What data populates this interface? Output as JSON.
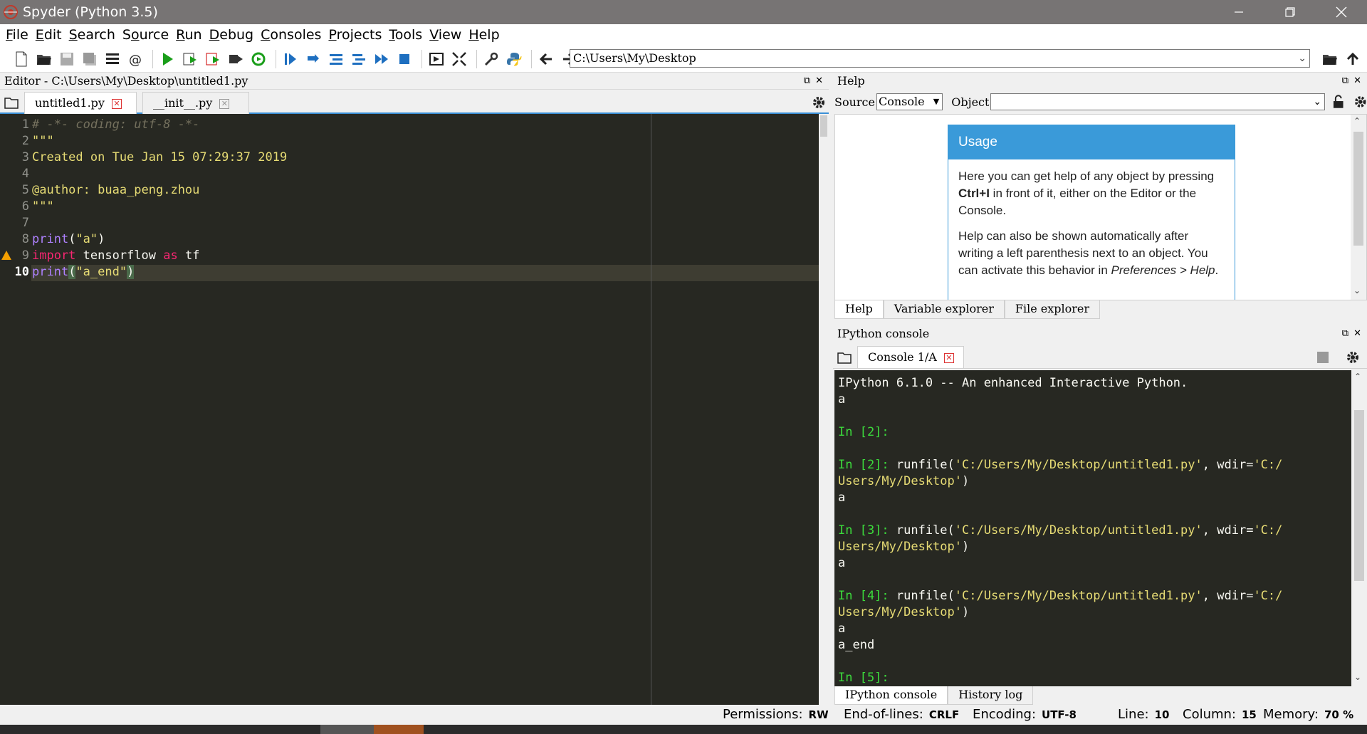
{
  "window": {
    "title": "Spyder (Python 3.5)"
  },
  "menu": [
    "File",
    "Edit",
    "Search",
    "Source",
    "Run",
    "Debug",
    "Consoles",
    "Projects",
    "Tools",
    "View",
    "Help"
  ],
  "menu_underline": [
    "F",
    "E",
    "S",
    "o",
    "R",
    "D",
    "C",
    "P",
    "T",
    "V",
    "H"
  ],
  "toolbar": {
    "path": "C:\\Users\\My\\Desktop"
  },
  "editor": {
    "header": "Editor - C:\\Users\\My\\Desktop\\untitled1.py",
    "tabs": [
      {
        "label": "untitled1.py",
        "active": true
      },
      {
        "label": "__init__.py",
        "active": false
      }
    ],
    "line_numbers": [
      "1",
      "2",
      "3",
      "4",
      "5",
      "6",
      "7",
      "8",
      "9",
      "10"
    ],
    "current_line": "10",
    "warning_line": "9",
    "lines": [
      "# -*- coding: utf-8 -*-",
      "\"\"\"",
      "Created on Tue Jan 15 07:29:37 2019",
      "",
      "@author: buaa_peng.zhou",
      "\"\"\"",
      "",
      "print(\"a\")",
      "import tensorflow as tf",
      "print(\"a_end\")"
    ],
    "tokens": {
      "l8_fn": "print",
      "l8_rest1": "(",
      "l8_str": "\"a\"",
      "l8_rest2": ")",
      "l9_kw1": "import",
      "l9_mid": " tensorflow ",
      "l9_kw2": "as",
      "l9_end": " tf",
      "l10_fn": "print",
      "l10_rest1": "(",
      "l10_str": "\"a_end\"",
      "l10_rest2": ")"
    }
  },
  "help": {
    "header": "Help",
    "source_label": "Source",
    "source_value": "Console",
    "object_label": "Object",
    "object_value": "",
    "usage_title": "Usage",
    "usage_p1_a": "Here you can get help of any object by pressing ",
    "usage_p1_b": "Ctrl+I",
    "usage_p1_c": " in front of it, either on the Editor or the Console.",
    "usage_p2_a": "Help can also be shown automatically after writing a left parenthesis next to an object. You can activate this behavior in ",
    "usage_p2_b": "Preferences > Help",
    "usage_p2_c": ".",
    "tabs": [
      "Help",
      "Variable explorer",
      "File explorer"
    ]
  },
  "ipython": {
    "header": "IPython console",
    "tab_label": "Console 1/A",
    "lines": {
      "l1": "IPython 6.1.0 -- An enhanced Interactive Python.",
      "l2": "a",
      "p2": "In [2]:",
      "p2b": "In [2]:",
      "run_cmd_a": " runfile(",
      "run_str1": "'C:/Users/My/Desktop/untitled1.py'",
      "run_mid": ", wdir=",
      "run_str2a": "'C:/",
      "run_str2b": "Users/My/Desktop'",
      "run_close": ")",
      "out_a": "a",
      "p3": "In [3]:",
      "p4": "In [4]:",
      "out_end": "a_end",
      "p5": "In [5]:"
    },
    "tabs": [
      "IPython console",
      "History log"
    ]
  },
  "status": {
    "permissions_label": "Permissions:",
    "permissions": "RW",
    "eol_label": "End-of-lines:",
    "eol": "CRLF",
    "encoding_label": "Encoding:",
    "encoding": "UTF-8",
    "line_label": "Line:",
    "line": "10",
    "column_label": "Column:",
    "column": "15",
    "memory_label": "Memory:",
    "memory": "70 %"
  }
}
